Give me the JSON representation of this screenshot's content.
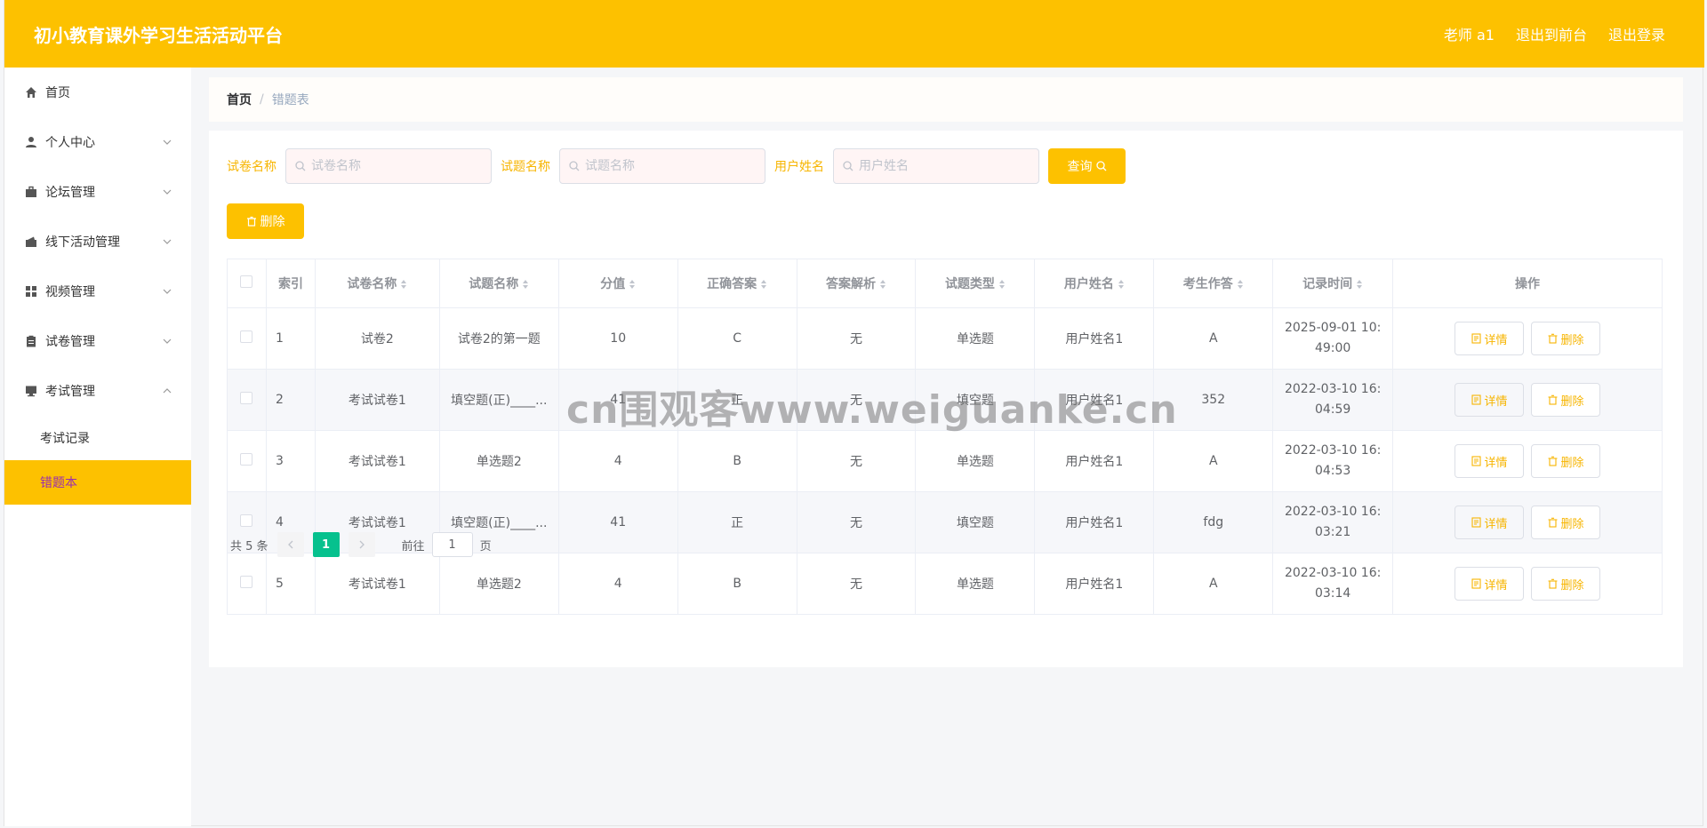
{
  "header": {
    "title": "初小教育课外学习生活活动平台",
    "nav": [
      "老师 a1",
      "退出到前台",
      "退出登录"
    ]
  },
  "sidebar": {
    "items": [
      {
        "label": "首页",
        "icon": "home-icon",
        "arrow": ""
      },
      {
        "label": "个人中心",
        "icon": "user-icon",
        "arrow": "down"
      },
      {
        "label": "论坛管理",
        "icon": "briefcase-icon",
        "arrow": "down"
      },
      {
        "label": "线下活动管理",
        "icon": "wallet-icon",
        "arrow": "down"
      },
      {
        "label": "视频管理",
        "icon": "grid-icon",
        "arrow": "down"
      },
      {
        "label": "试卷管理",
        "icon": "clipboard-icon",
        "arrow": "down"
      },
      {
        "label": "考试管理",
        "icon": "monitor-icon",
        "arrow": "up"
      }
    ],
    "submenu": [
      {
        "label": "考试记录",
        "active": false
      },
      {
        "label": "错题本",
        "active": true
      }
    ]
  },
  "breadcrumb": {
    "home": "首页",
    "sep": "/",
    "current": "错题表"
  },
  "search": {
    "fields": [
      {
        "label": "试卷名称",
        "placeholder": "试卷名称"
      },
      {
        "label": "试题名称",
        "placeholder": "试题名称"
      },
      {
        "label": "用户姓名",
        "placeholder": "用户姓名"
      }
    ],
    "query_label": "查询"
  },
  "actions": {
    "delete_label": "删除"
  },
  "table": {
    "headers": [
      "索引",
      "试卷名称",
      "试题名称",
      "分值",
      "正确答案",
      "答案解析",
      "试题类型",
      "用户姓名",
      "考生作答",
      "记录时间",
      "操作"
    ],
    "rows": [
      [
        "1",
        "试卷2",
        "试卷2的第一题",
        "10",
        "C",
        "无",
        "单选题",
        "用户姓名1",
        "A",
        "2025-09-01 10:49:00"
      ],
      [
        "2",
        "考试试卷1",
        "填空题(正)____...",
        "41",
        "正",
        "无",
        "填空题",
        "用户姓名1",
        "352",
        "2022-03-10 16:04:59"
      ],
      [
        "3",
        "考试试卷1",
        "单选题2",
        "4",
        "B",
        "无",
        "单选题",
        "用户姓名1",
        "A",
        "2022-03-10 16:04:53"
      ],
      [
        "4",
        "考试试卷1",
        "填空题(正)____...",
        "41",
        "正",
        "无",
        "填空题",
        "用户姓名1",
        "fdg",
        "2022-03-10 16:03:21"
      ],
      [
        "5",
        "考试试卷1",
        "单选题2",
        "4",
        "B",
        "无",
        "单选题",
        "用户姓名1",
        "A",
        "2022-03-10 16:03:14"
      ]
    ],
    "row_actions": {
      "detail": "详情",
      "delete": "删除"
    }
  },
  "pager": {
    "total": "共 5 条",
    "current": "1",
    "goto_prefix": "前往",
    "goto_value": "1",
    "goto_suffix": "页"
  },
  "watermark": "cn围观客www.weiguanke.cn",
  "colors": {
    "accent": "#fdc100",
    "active_text": "#9b2fae",
    "pager_active": "#06c18e",
    "label": "#f7b500"
  }
}
